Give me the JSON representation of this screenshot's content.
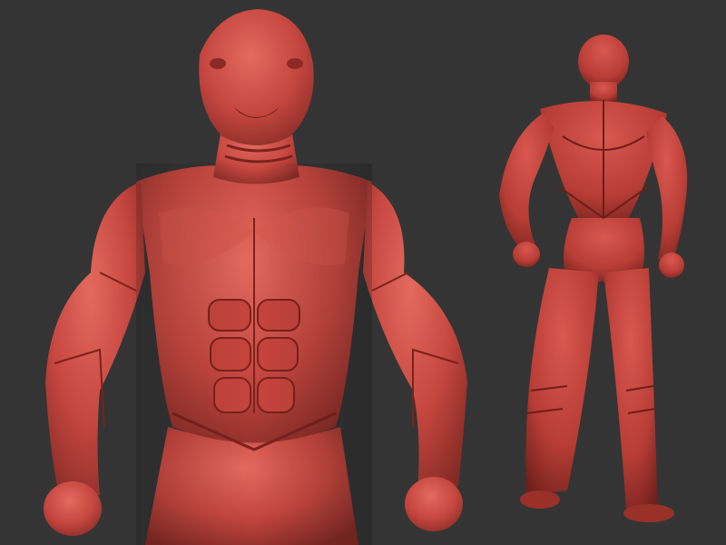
{
  "scene": {
    "background_color": "#343434",
    "material_color": "#c8473f",
    "material_highlight": "#e0665b",
    "material_shadow": "#7e2520",
    "views": [
      "front-closeup",
      "back-full-body"
    ]
  }
}
